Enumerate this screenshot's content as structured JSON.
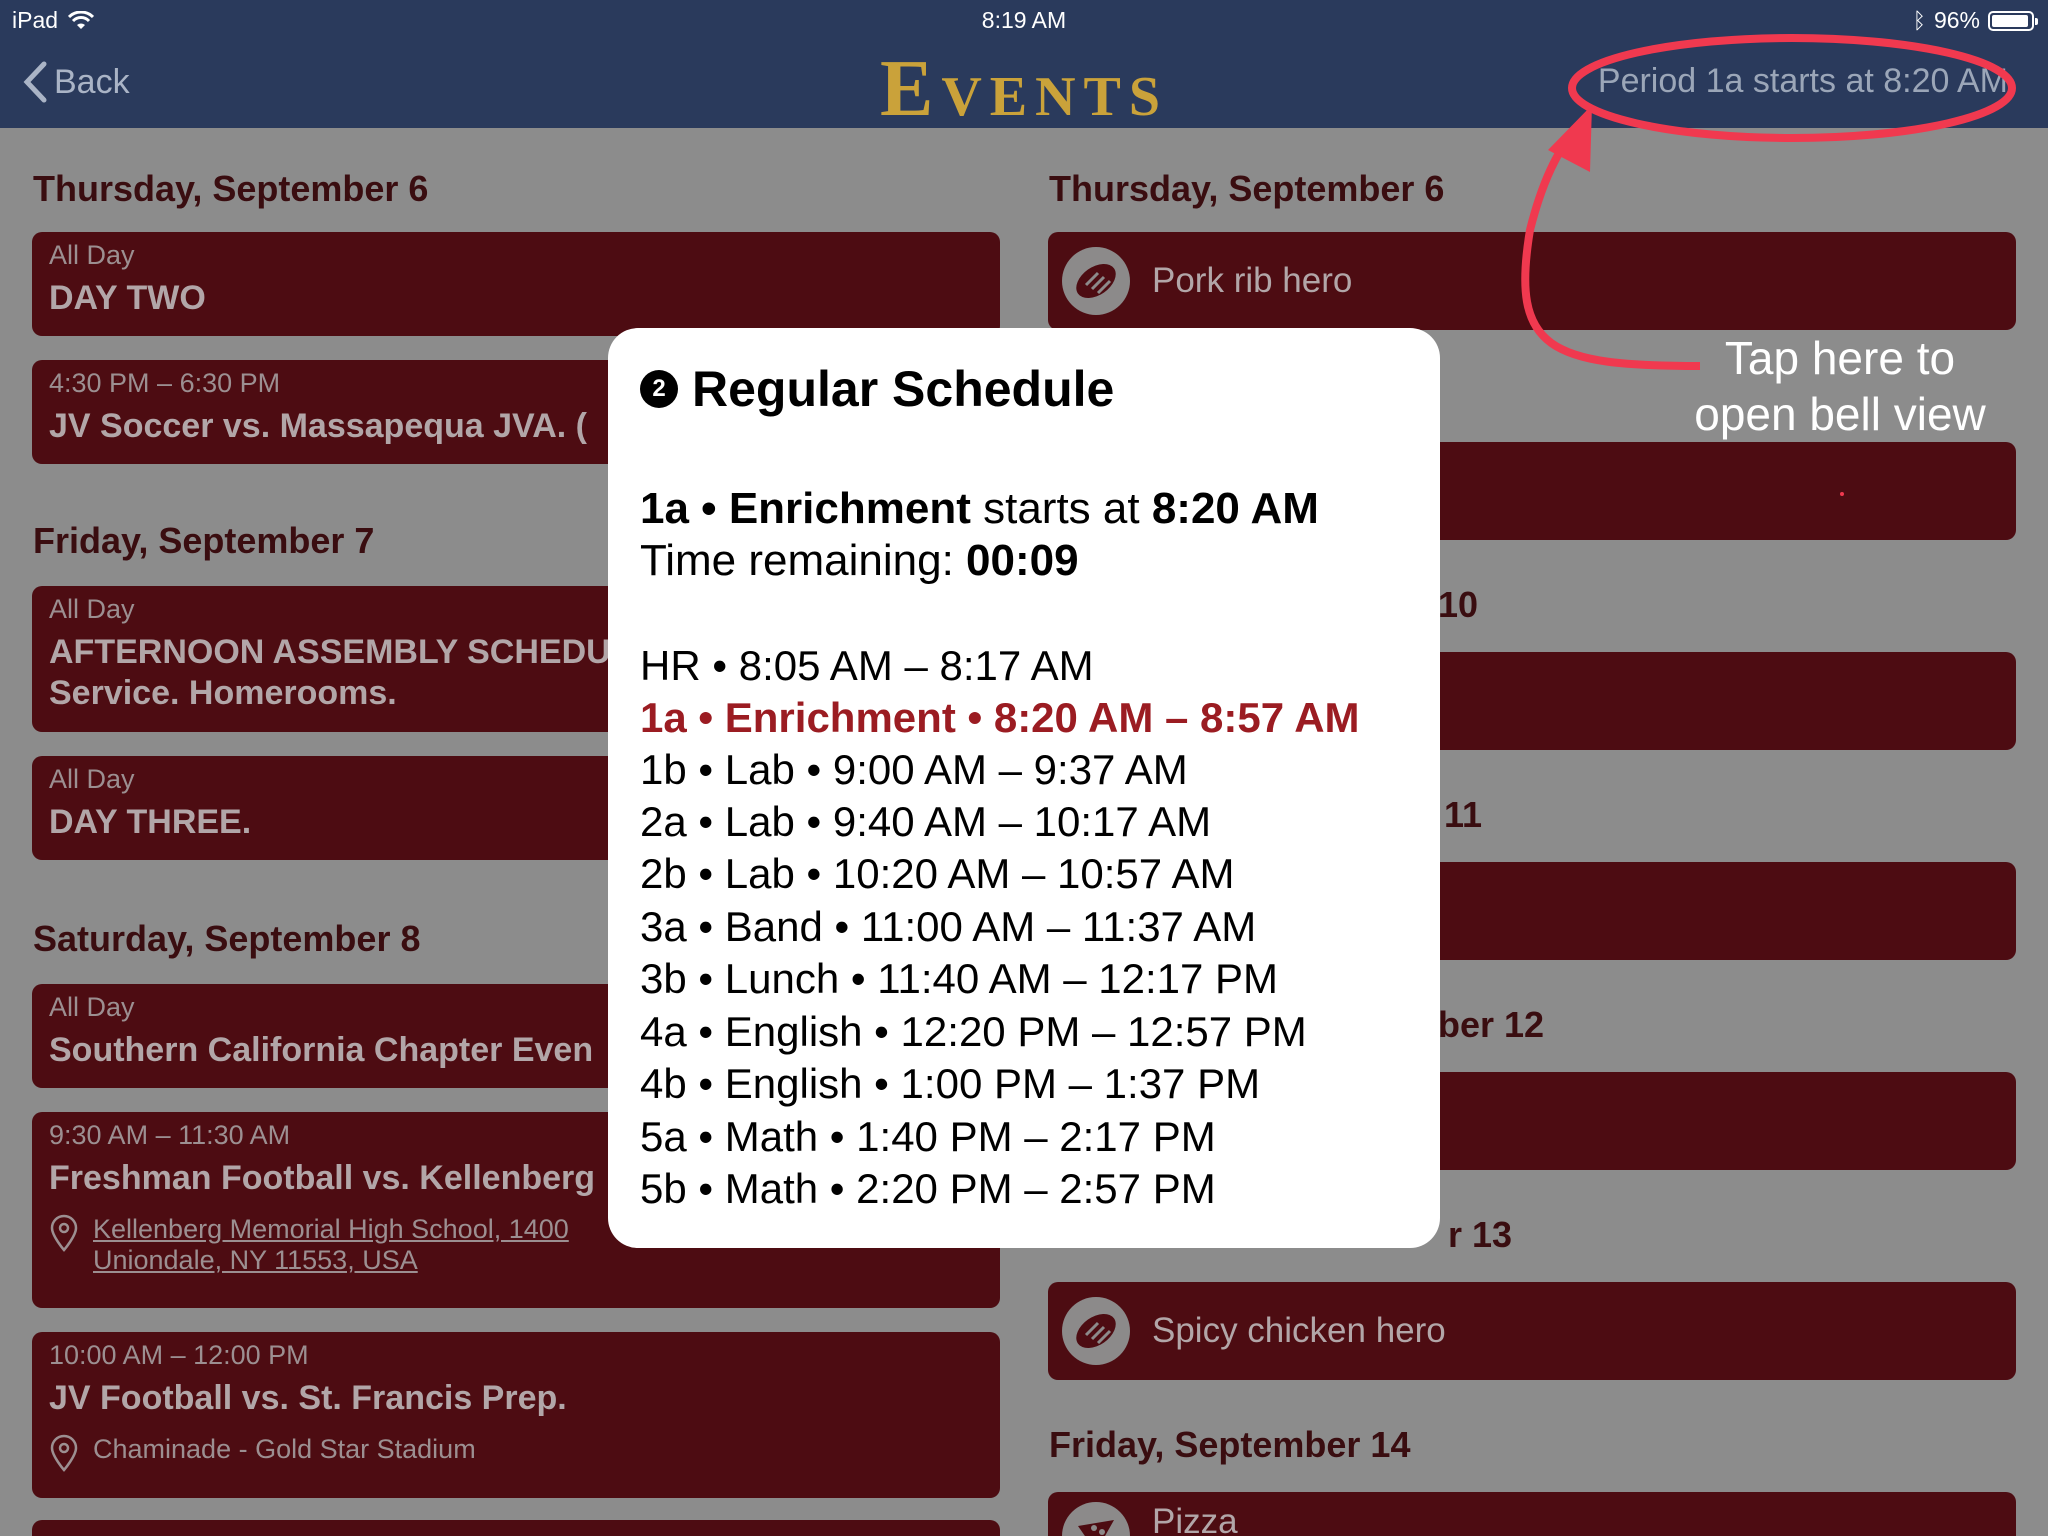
{
  "status_bar": {
    "device": "iPad",
    "time": "8:19 AM",
    "battery": "96%"
  },
  "nav": {
    "back_label": "Back",
    "title": "Events",
    "bell_status": "Period 1a starts at 8:20 AM"
  },
  "left_column": {
    "days": [
      {
        "header": "Thursday, September 6",
        "events": [
          {
            "time": "All Day",
            "name": "DAY TWO"
          },
          {
            "time": "4:30 PM – 6:30 PM",
            "name": "JV Soccer vs. Massapequa JVA. ("
          }
        ]
      },
      {
        "header": "Friday, September 7",
        "events": [
          {
            "time": "All Day",
            "name": "AFTERNOON ASSEMBLY SCHEDU",
            "name2": "Service. Homerooms."
          },
          {
            "time": "All Day",
            "name": "DAY THREE."
          }
        ]
      },
      {
        "header": "Saturday, September 8",
        "events": [
          {
            "time": "All Day",
            "name": "Southern California Chapter Even"
          },
          {
            "time": "9:30 AM – 11:30 AM",
            "name": "Freshman Football vs. Kellenberg",
            "location": "Kellenberg Memorial High School, 1400",
            "location2": "Uniondale, NY 11553, USA"
          },
          {
            "time": "10:00 AM – 12:00 PM",
            "name": "JV Football vs. St. Francis Prep.",
            "location": "Chaminade - Gold Star Stadium"
          }
        ]
      }
    ]
  },
  "right_column": {
    "headers": {
      "thu6": "Thursday, September 6",
      "mon10": "10",
      "tue11": "11",
      "wed12": "ber 12",
      "thu13": "r 13",
      "fri14": "Friday, September 14"
    },
    "food": {
      "thu6": "Pork rib hero",
      "thu13": "Spicy chicken hero",
      "fri14": "Pizza"
    }
  },
  "modal": {
    "badge": "2",
    "title": "Regular Schedule",
    "current": {
      "period": "1a",
      "name": "Enrichment",
      "starts_text": "starts at",
      "start": "8:20 AM",
      "remaining_label": "Time remaining:",
      "remaining": "00:09"
    },
    "periods": [
      {
        "text": "HR • 8:05 AM – 8:17 AM",
        "current": false
      },
      {
        "text": "1a • Enrichment • 8:20 AM – 8:57 AM",
        "current": true
      },
      {
        "text": "1b • Lab • 9:00 AM – 9:37 AM",
        "current": false
      },
      {
        "text": "2a • Lab • 9:40 AM – 10:17 AM",
        "current": false
      },
      {
        "text": "2b • Lab • 10:20 AM – 10:57 AM",
        "current": false
      },
      {
        "text": "3a • Band • 11:00 AM – 11:37 AM",
        "current": false
      },
      {
        "text": "3b • Lunch • 11:40 AM – 12:17 PM",
        "current": false
      },
      {
        "text": "4a • English • 12:20 PM – 12:57 PM",
        "current": false
      },
      {
        "text": "4b • English • 1:00 PM – 1:37 PM",
        "current": false
      },
      {
        "text": "5a • Math • 1:40 PM – 2:17 PM",
        "current": false
      },
      {
        "text": "5b • Math • 2:20 PM – 2:57 PM",
        "current": false
      }
    ]
  },
  "annotation": {
    "line1": "Tap here to",
    "line2": "open bell view"
  },
  "colors": {
    "nav": "#2a3a5c",
    "card": "#4d0c12",
    "accent_red": "#9b1c22",
    "annotation": "#f0394f",
    "title_gold": "#caa23a"
  }
}
